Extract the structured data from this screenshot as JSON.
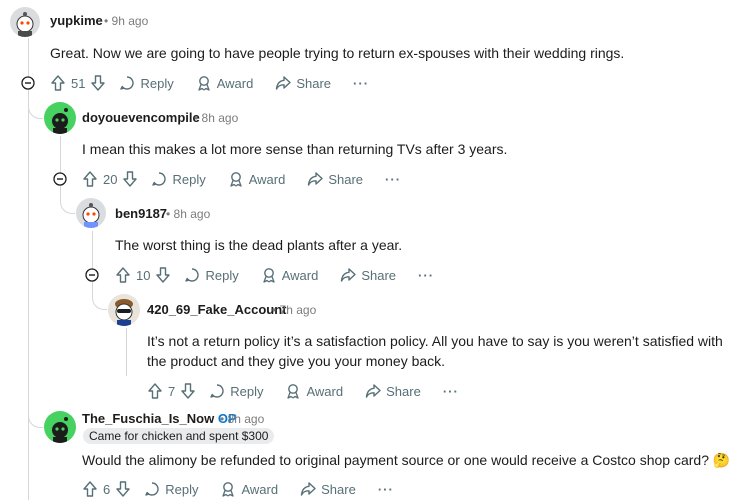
{
  "comments": [
    {
      "username": "yupkime",
      "time": "9h ago",
      "body": "Great. Now we are going to have people trying to return ex-spouses with their wedding rings.",
      "score": "51"
    },
    {
      "username": "doyouevencompile",
      "time": "8h ago",
      "body": "I mean this makes a lot more sense than returning TVs after 3 years.",
      "score": "20"
    },
    {
      "username": "ben9187",
      "time": "8h ago",
      "body": "The worst thing is the dead plants after a year.",
      "score": "10"
    },
    {
      "username": "420_69_Fake_Account",
      "time": "7h ago",
      "body": "It’s not a return policy it’s a satisfaction policy. All you have to say is you weren’t satisfied with the product and they give you your money back.",
      "score": "7"
    },
    {
      "username": "The_Fuschia_Is_Now",
      "op_badge": "OP",
      "time": "8h ago",
      "flair": "Came for chicken and spent $300",
      "body": "Would the alimony be refunded to original payment source or one would receive a Costco shop card? 🤔",
      "score": "6"
    }
  ],
  "actions": {
    "reply": "Reply",
    "award": "Award",
    "share": "Share",
    "more": "···",
    "separator": "•"
  },
  "colors": {
    "thread_line": "#d4d7d9",
    "icon": "#576f76",
    "op": "#0079d3",
    "green_avatar": "#46d160"
  }
}
